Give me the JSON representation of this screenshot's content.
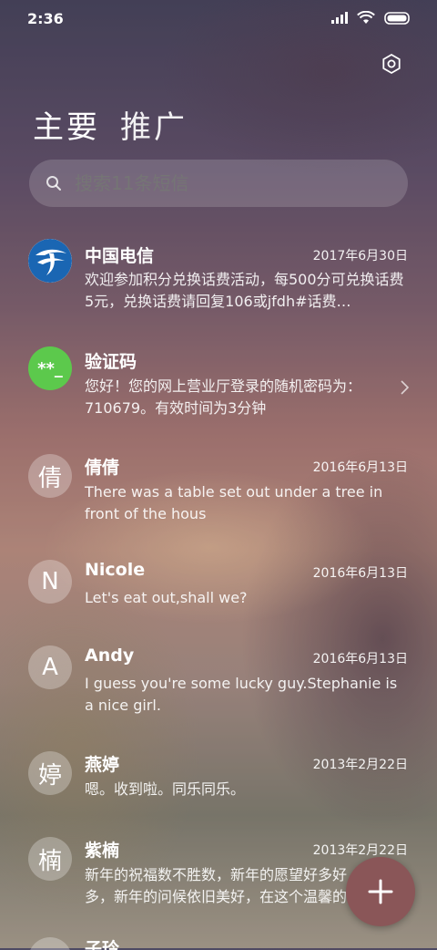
{
  "status_bar": {
    "time": "2:36"
  },
  "header": {
    "tabs": [
      {
        "label": "主要"
      },
      {
        "label": "推广"
      }
    ]
  },
  "search": {
    "placeholder": "搜索11条短信"
  },
  "threads": [
    {
      "avatar_text": "",
      "avatar_kind": "china-telecom-logo",
      "name": "中国电信",
      "date": "2017年6月30日",
      "snippet": "欢迎参加积分兑换话费活动，每500分可兑换话费5元，兑换话费请回复106或jfdh#话费…"
    },
    {
      "avatar_text": "**_",
      "avatar_kind": "verification",
      "name": "验证码",
      "date": "",
      "snippet": "您好！您的网上营业厅登录的随机密码为：710679。有效时间为3分钟"
    },
    {
      "avatar_text": "倩",
      "name": "倩倩",
      "date": "2016年6月13日",
      "snippet": "There was a table set out under a tree in front of the hous"
    },
    {
      "avatar_text": "N",
      "name": "Nicole",
      "date": "2016年6月13日",
      "snippet": "Let's eat out,shall we?"
    },
    {
      "avatar_text": "A",
      "name": "Andy",
      "date": "2016年6月13日",
      "snippet": "I guess you're some lucky guy.Stephanie is a nice girl."
    },
    {
      "avatar_text": "婷",
      "name": "燕婷",
      "date": "2013年2月22日",
      "snippet": "嗯。收到啦。同乐同乐。"
    },
    {
      "avatar_text": "楠",
      "name": "紫楠",
      "date": "2013年2月22日",
      "snippet": "新年的祝福数不胜数，新年的愿望好多好多，新年的问候依旧美好，在这个温馨的时刻"
    },
    {
      "avatar_text": "",
      "name": "子玲",
      "date": "",
      "snippet": ""
    }
  ],
  "fab": {
    "icon": "plus-icon"
  }
}
